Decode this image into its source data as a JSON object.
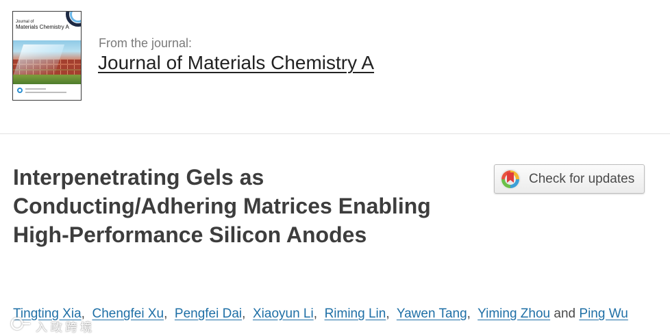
{
  "journal": {
    "from_label": "From the journal:",
    "name": "Journal of Materials Chemistry A",
    "cover": {
      "title_small": "Journal of",
      "title_big": "Materials Chemistry A"
    }
  },
  "article": {
    "title": "Interpenetrating Gels as Conducting/Adhering Matrices Enabling High-Performance Silicon Anodes"
  },
  "check_updates": {
    "label": "Check for updates"
  },
  "authors": {
    "names": [
      "Tingting Xia",
      "Chengfei Xu",
      "Pengfei Dai",
      "Xiaoyun Li",
      "Riming Lin",
      "Yawen Tang",
      "Yiming Zhou",
      "Ping Wu"
    ],
    "separator": ",",
    "and_word": "and"
  },
  "watermark": {
    "text": "入 政 跨 境"
  },
  "colors": {
    "link": "#1e6fa6",
    "title": "#3d3d3d",
    "divider": "#e2e2e2"
  }
}
